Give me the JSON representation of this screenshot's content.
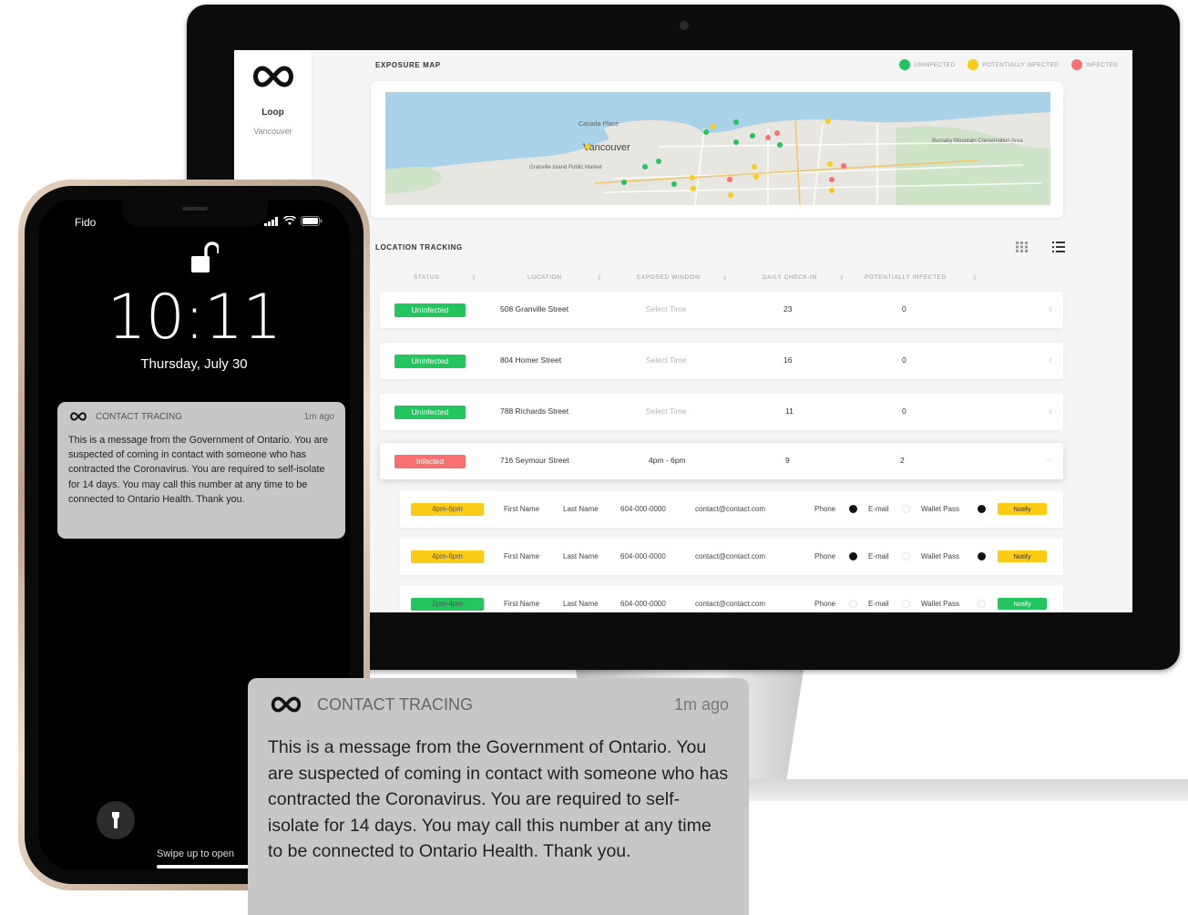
{
  "app": {
    "name": "Loop",
    "city": "Vancouver",
    "exposure_map_title": "EXPOSURE MAP",
    "location_tracking_title": "LOCATION TRACKING",
    "legend": [
      {
        "label": "UNINFECTED",
        "color": "#22c55e"
      },
      {
        "label": "POTENTIALLY INFECTED",
        "color": "#facc15"
      },
      {
        "label": "INFECTED",
        "color": "#f87171"
      }
    ],
    "map_labels": {
      "city": "Vancouver",
      "canada_place": "Canada Place",
      "granville_island": "Granville Island Public Market",
      "burnaby": "Burnaby Mountain Conservation Area"
    },
    "columns": [
      "STATUS",
      "LOCATION",
      "EXPOSED WINDOW",
      "DAILY CHECK-IN",
      "POTENTIALLY INFECTED"
    ],
    "rows": [
      {
        "status": "Uninfected",
        "location": "508 Granville Street",
        "window": "Select Time",
        "checkin": "23",
        "potential": "0"
      },
      {
        "status": "Uninfected",
        "location": "804 Homer Street",
        "window": "Select Time",
        "checkin": "16",
        "potential": "0"
      },
      {
        "status": "Uninfected",
        "location": "788 Richards Street",
        "window": "Select Time",
        "checkin": "11",
        "potential": "0"
      },
      {
        "status": "Infected",
        "location": "716 Seymour Street",
        "window": "4pm - 6pm",
        "checkin": "9",
        "potential": "2"
      }
    ],
    "contacts": [
      {
        "window": "4pm-6pm",
        "first": "First Name",
        "last": "Last Name",
        "phone": "604-000-0000",
        "email": "contact@contact.com",
        "phone_label": "Phone",
        "email_label": "E-mail",
        "wallet_label": "Wallet Pass",
        "phone_on": true,
        "email_on": false,
        "wallet_on": true,
        "notify": "Notify",
        "color": "#facc15"
      },
      {
        "window": "4pm-6pm",
        "first": "First Name",
        "last": "Last Name",
        "phone": "604-000-0000",
        "email": "contact@contact.com",
        "phone_label": "Phone",
        "email_label": "E-mail",
        "wallet_label": "Wallet Pass",
        "phone_on": true,
        "email_on": false,
        "wallet_on": true,
        "notify": "Notify",
        "color": "#facc15"
      },
      {
        "window": "2pm-4pm",
        "first": "First Name",
        "last": "Last Name",
        "phone": "604-000-0000",
        "email": "contact@contact.com",
        "phone_label": "Phone",
        "email_label": "E-mail",
        "wallet_label": "Wallet Pass",
        "phone_on": false,
        "email_on": false,
        "wallet_on": false,
        "notify": "Notify",
        "color": "#22c55e"
      }
    ]
  },
  "phone": {
    "carrier": "Fido",
    "time": "10:11",
    "date": "Thursday, July 30",
    "swipe_hint": "Swipe up to open",
    "icons": [
      "signal-icon",
      "wifi-icon",
      "battery-icon",
      "unlocked-padlock-icon",
      "flashlight-icon"
    ]
  },
  "notification": {
    "app": "CONTACT TRACING",
    "ago": "1m ago",
    "body": "This is a message from the Government of Ontario. You are suspected of coming in contact with someone who has contracted the Coronavirus. You are required to self-isolate for 14 days. You may call this number at any time to be connected to Ontario Health. Thank you."
  }
}
